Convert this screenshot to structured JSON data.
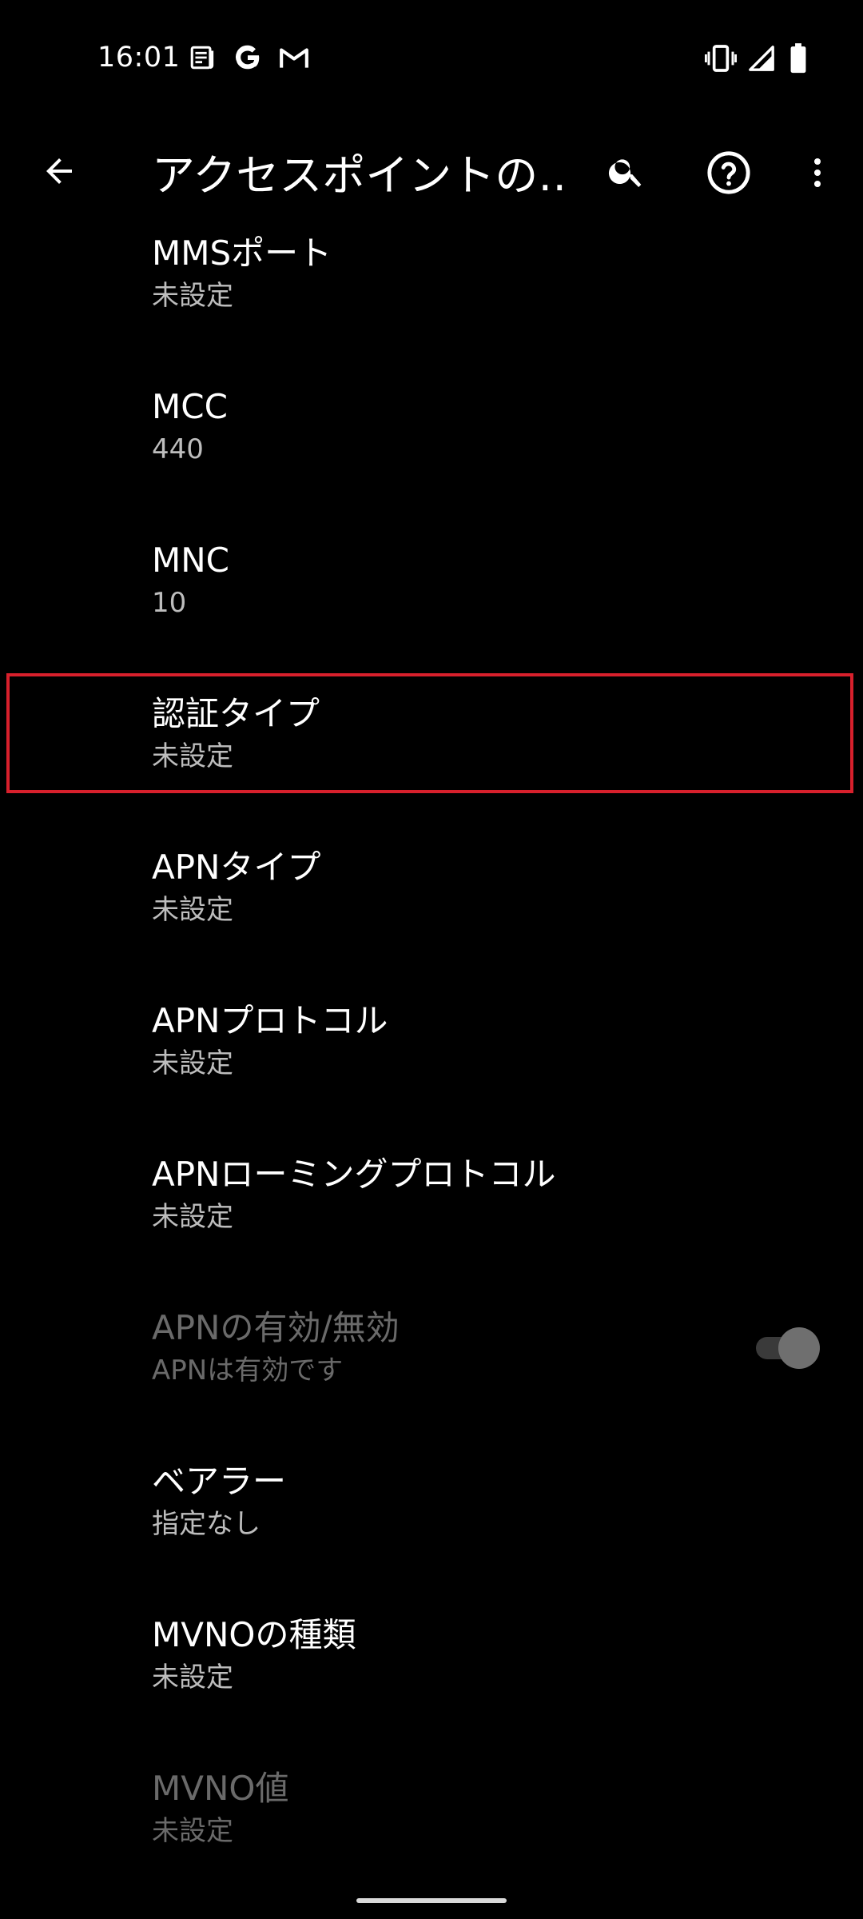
{
  "status_bar": {
    "time": "16:01",
    "left_icons": [
      "news-icon",
      "google-icon",
      "gmail-icon"
    ],
    "right_icons": [
      "vibrate-icon",
      "signal-icon",
      "battery-icon"
    ]
  },
  "app_bar": {
    "title": "アクセスポイントの…",
    "back_icon": "arrow-back-icon",
    "search_icon": "search-icon",
    "help_icon": "help-icon",
    "more_icon": "more-vert-icon"
  },
  "items": [
    {
      "title": "MMSポート",
      "summary": "未設定"
    },
    {
      "title": "MCC",
      "summary": "440"
    },
    {
      "title": "MNC",
      "summary": "10"
    },
    {
      "title": "認証タイプ",
      "summary": "未設定"
    },
    {
      "title": "APNタイプ",
      "summary": "未設定"
    },
    {
      "title": "APNプロトコル",
      "summary": "未設定"
    },
    {
      "title": "APNローミングプロトコル",
      "summary": "未設定"
    },
    {
      "title": "APNの有効/無効",
      "summary": "APNは有効です",
      "toggle_on": true,
      "enabled": false
    },
    {
      "title": "ベアラー",
      "summary": "指定なし"
    },
    {
      "title": "MVNOの種類",
      "summary": "未設定"
    },
    {
      "title": "MVNO値",
      "summary": "未設定",
      "enabled": false
    }
  ],
  "colors": {
    "background": "#000000",
    "title": "#ffffff",
    "summary": "#bdbdbd",
    "disabled": "#6a6a6a",
    "highlight": "#d8202c"
  }
}
